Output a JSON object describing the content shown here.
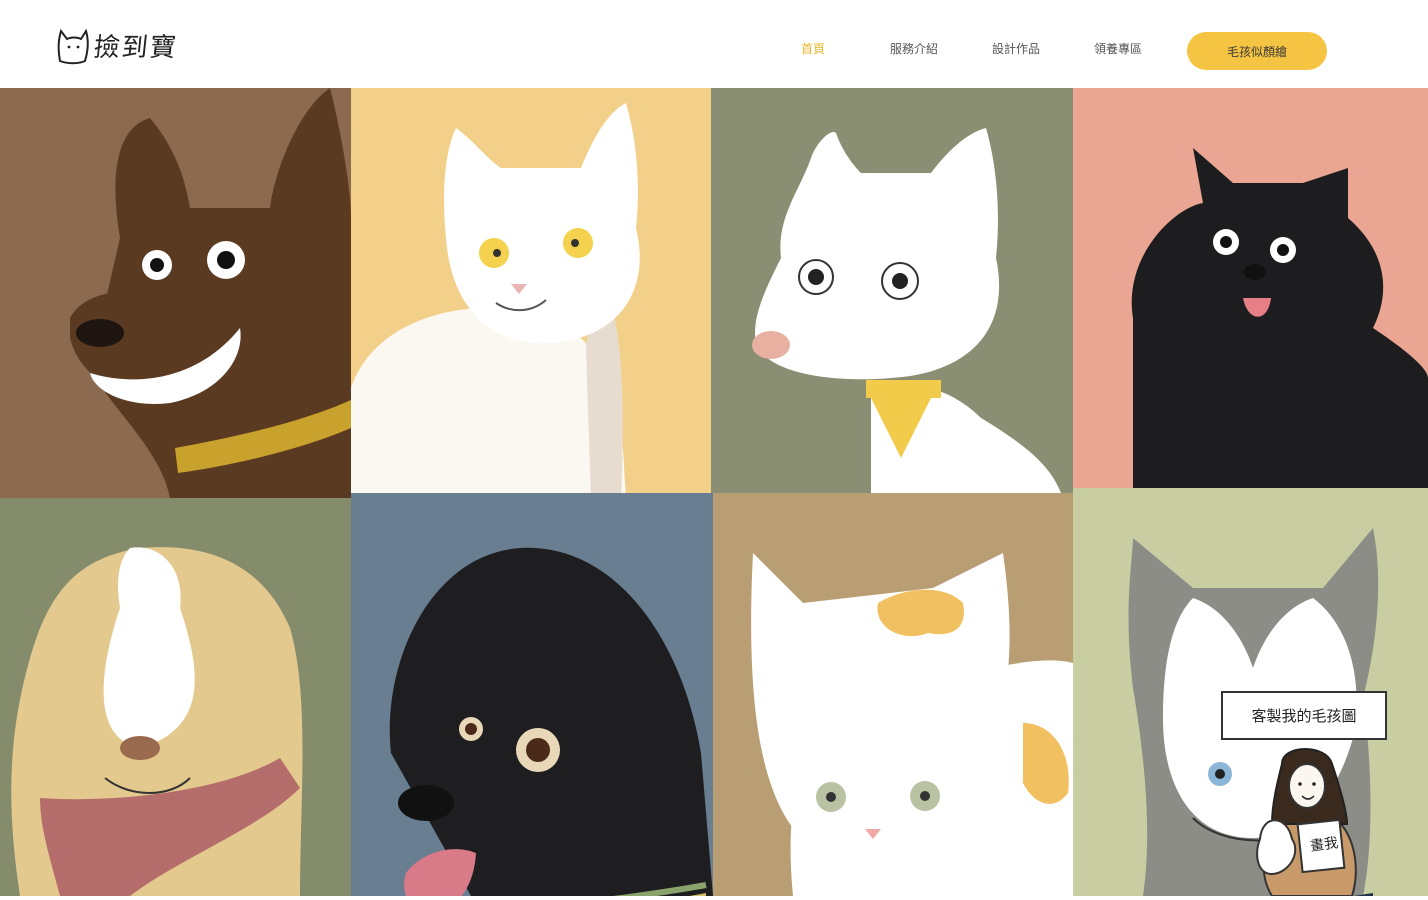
{
  "header": {
    "logo_text": "撿到寶",
    "nav": [
      {
        "label": "首頁",
        "active": true
      },
      {
        "label": "服務介紹",
        "active": false
      },
      {
        "label": "設計作品",
        "active": false
      },
      {
        "label": "領養專區",
        "active": false
      }
    ],
    "cta_label": "毛孩似顏繪"
  },
  "gallery": {
    "tiles": [
      {
        "subject": "brown dog",
        "bg": "#8c6a4f"
      },
      {
        "subject": "white cat",
        "bg": "#f2d089"
      },
      {
        "subject": "white dog",
        "bg": "#8a8e72"
      },
      {
        "subject": "black fluffy dog",
        "bg": "#eaa693"
      },
      {
        "subject": "cream dog with scarf",
        "bg": "#848c6c"
      },
      {
        "subject": "black dog",
        "bg": "#6a7e92"
      },
      {
        "subject": "calico cat",
        "bg": "#b89e72"
      },
      {
        "subject": "husky",
        "bg": "#c8cea2"
      }
    ]
  },
  "widget": {
    "label": "客製我的毛孩圖",
    "sign_text": "畫我"
  },
  "colors": {
    "accent": "#f6c443",
    "nav_active": "#e8b62c"
  }
}
